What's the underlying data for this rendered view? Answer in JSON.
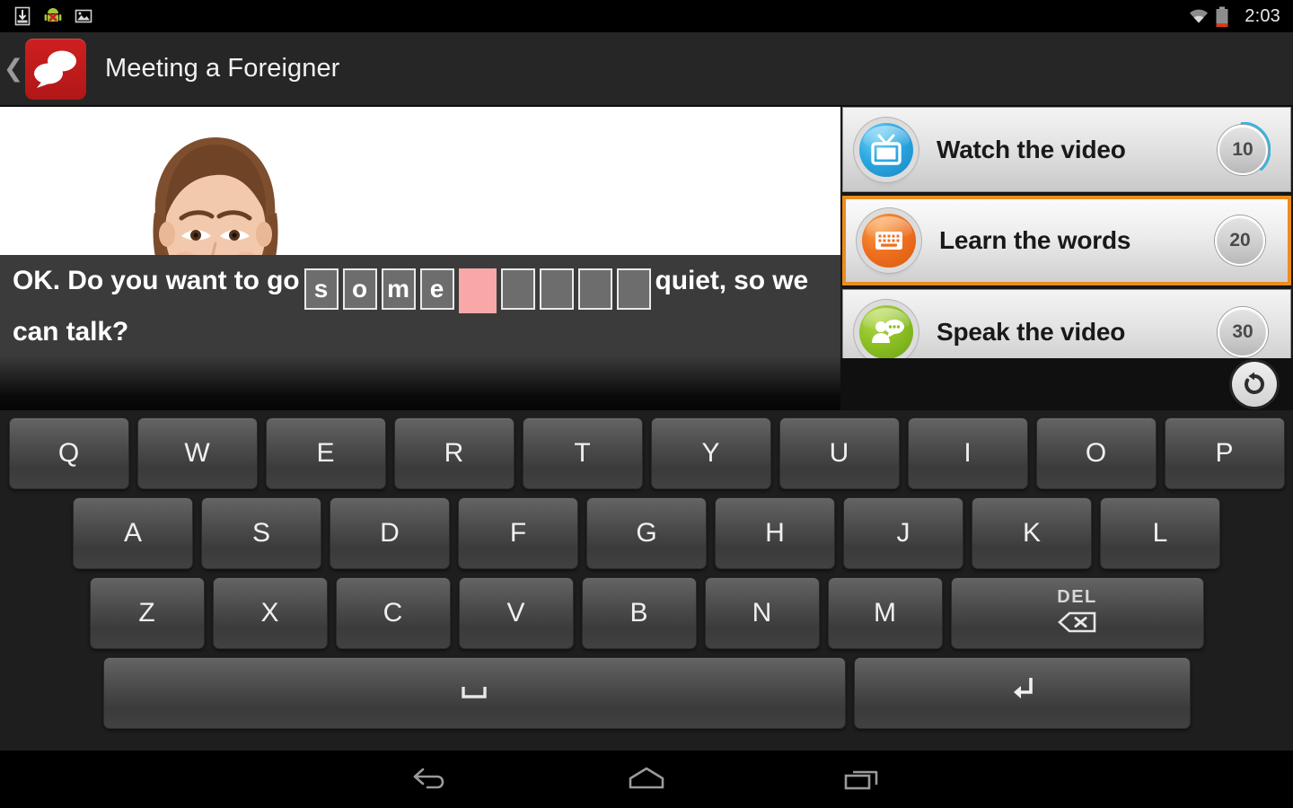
{
  "statusbar": {
    "icons": [
      "download-icon",
      "android-error-icon",
      "image-icon"
    ],
    "wifi_icon": "wifi-icon",
    "battery_icon": "battery-low-icon",
    "clock": "2:03"
  },
  "actionbar": {
    "back_icon": "back-chevron-icon",
    "app_icon": "speech-bubbles-icon",
    "title": "Meeting a Foreigner"
  },
  "video": {
    "portrait_alt": "smiling-woman-portrait"
  },
  "subtitle": {
    "prefix": "OK. Do you want to go",
    "suffix": "quiet, so we can talk?",
    "cells": [
      {
        "letter": "s",
        "state": "filled"
      },
      {
        "letter": "o",
        "state": "filled"
      },
      {
        "letter": "m",
        "state": "filled"
      },
      {
        "letter": "e",
        "state": "filled"
      },
      {
        "letter": "",
        "state": "active"
      },
      {
        "letter": "",
        "state": "blank"
      },
      {
        "letter": "",
        "state": "blank"
      },
      {
        "letter": "",
        "state": "blank"
      },
      {
        "letter": "",
        "state": "blank"
      }
    ]
  },
  "tasks": [
    {
      "label": "Watch the video",
      "score": "10",
      "icon": "tv-icon",
      "icon_color": "#2ba6e0",
      "selected": false,
      "progress_arc": true,
      "arc_color": "#33b5e5"
    },
    {
      "label": "Learn the words",
      "score": "20",
      "icon": "keyboard-icon",
      "icon_color": "#ef7020",
      "selected": true,
      "progress_arc": false,
      "arc_color": "#33b5e5"
    },
    {
      "label": "Speak the video",
      "score": "30",
      "icon": "speak-person-icon",
      "icon_color": "#8cc024",
      "selected": false,
      "progress_arc": false,
      "arc_color": "#33b5e5"
    }
  ],
  "selection_color": "#eb8c1e",
  "replay": {
    "icon": "replay-icon"
  },
  "keyboard": {
    "row1": [
      "Q",
      "W",
      "E",
      "R",
      "T",
      "Y",
      "U",
      "I",
      "O",
      "P"
    ],
    "row2": [
      "A",
      "S",
      "D",
      "F",
      "G",
      "H",
      "J",
      "K",
      "L"
    ],
    "row3": [
      "Z",
      "X",
      "C",
      "V",
      "B",
      "N",
      "M"
    ],
    "del_label": "DEL",
    "del_icon": "backspace-icon",
    "space_icon": "space-icon",
    "enter_icon": "enter-icon"
  },
  "navbar": {
    "back": "nav-back-icon",
    "home": "nav-home-icon",
    "recents": "nav-recents-icon"
  }
}
